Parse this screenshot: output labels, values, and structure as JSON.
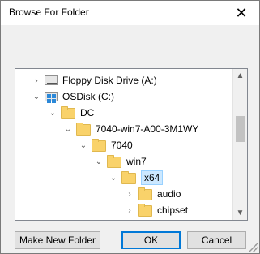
{
  "window": {
    "title": "Browse For Folder"
  },
  "tree": {
    "items": [
      {
        "label": "Floppy Disk Drive (A:)",
        "chevron": "›",
        "icon": "floppy-drive-icon"
      },
      {
        "label": "OSDisk (C:)",
        "chevron": "⌄",
        "icon": "windows-drive-icon"
      },
      {
        "label": "DC",
        "chevron": "⌄",
        "icon": "folder-icon"
      },
      {
        "label": "7040-win7-A00-3M1WY",
        "chevron": "⌄",
        "icon": "folder-icon"
      },
      {
        "label": "7040",
        "chevron": "⌄",
        "icon": "folder-icon"
      },
      {
        "label": "win7",
        "chevron": "⌄",
        "icon": "folder-icon"
      },
      {
        "label": "x64",
        "chevron": "⌄",
        "icon": "folder-icon",
        "selected": true
      },
      {
        "label": "audio",
        "chevron": "›",
        "icon": "folder-icon"
      },
      {
        "label": "chipset",
        "chevron": "›",
        "icon": "folder-icon"
      }
    ]
  },
  "buttons": {
    "make_new_folder": "Make New Folder",
    "ok": "OK",
    "cancel": "Cancel"
  },
  "icons": {
    "close": "✕",
    "scroll_up": "▲",
    "scroll_down": "▼"
  },
  "colors": {
    "selection_bg": "#cce8ff",
    "folder": "#f9d26a",
    "accent": "#0078d7"
  }
}
